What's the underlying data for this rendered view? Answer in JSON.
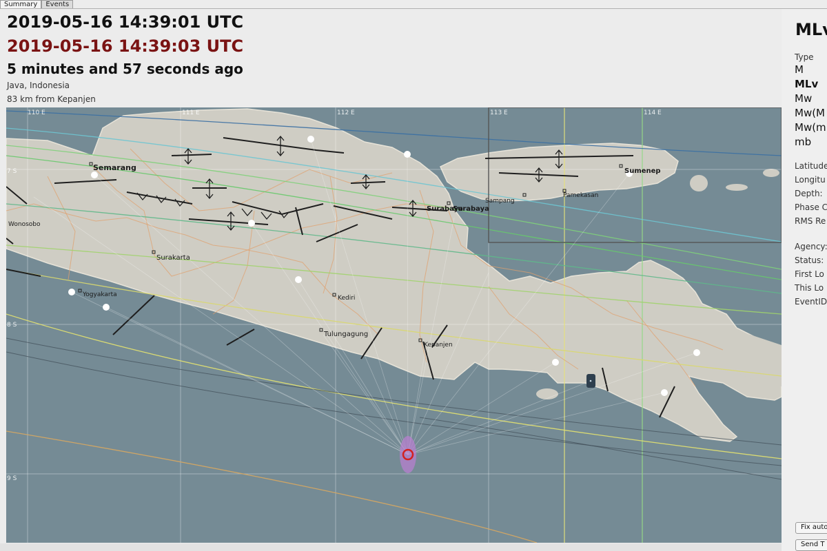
{
  "tabs": [
    "Summary",
    "Events"
  ],
  "header": {
    "origin_time": "2019-05-16 14:39:01 UTC",
    "latest_time": "2019-05-16 14:39:03 UTC",
    "ago": "5 minutes and 57 seconds ago",
    "region": "Java, Indonesia",
    "distance": "83 km from Kepanjen"
  },
  "map": {
    "lon_labels": [
      "110 E",
      "111 E",
      "112 E",
      "113 E",
      "114 E"
    ],
    "lat_labels": [
      "7 S",
      "8 S",
      "9 S"
    ],
    "cities": [
      "Semarang",
      "Wonosobo",
      "Surakarta",
      "Yogyakarta",
      "Kediri",
      "Tulungagung",
      "Kepanjen",
      "Surabaya",
      "Surabaya",
      "Sampang",
      "Pamekasan",
      "Sumenep"
    ],
    "colors": {
      "sea": "#758b95",
      "land": "#cfcdc4",
      "epicenter": "#d42020",
      "uncertainty": "#b77fcf"
    }
  },
  "panel": {
    "mag_title": "MLv",
    "type_label": "Type",
    "mag_types": [
      "M",
      "MLv",
      "Mw",
      "Mw(M",
      "Mw(m",
      "mb"
    ],
    "selected_mag": "MLv",
    "info1": [
      "Latitude",
      "Longitu",
      "Depth:",
      "Phase C",
      "RMS Re"
    ],
    "info2": [
      "Agency:",
      "Status:",
      "First Lo",
      "This Lo",
      "EventID"
    ],
    "btn_fix": "Fix auto",
    "btn_send": "Send T"
  }
}
